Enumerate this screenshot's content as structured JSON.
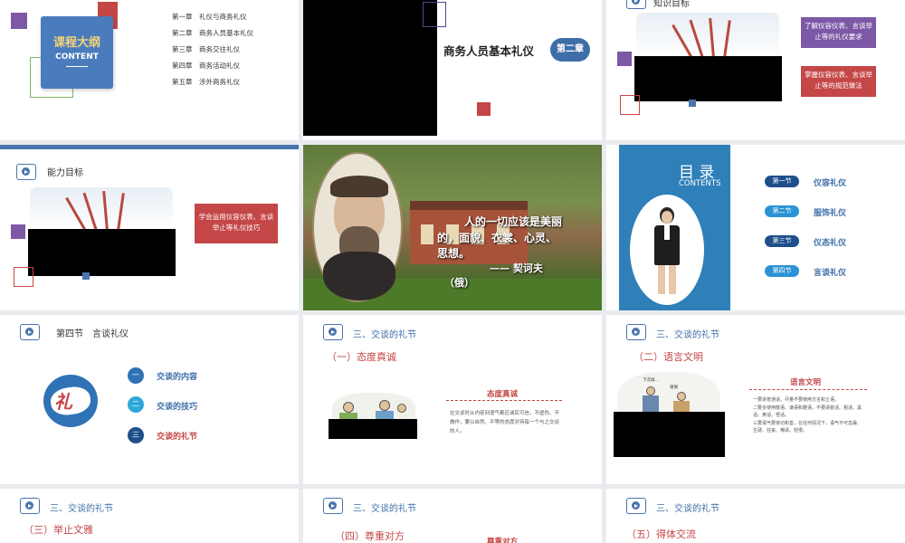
{
  "colors": {
    "accent_blue": "#4a74ab",
    "accent_red": "#c54646",
    "accent_purple": "#7d58a6"
  },
  "slide1": {
    "badge_title": "课程大纲",
    "badge_sub": "CONTENT",
    "chapters": [
      "第一章　礼仪与商务礼仪",
      "第二章　商务人员基本礼仪",
      "第三章　商务交往礼仪",
      "第四章　商务活动礼仪",
      "第五章　涉外商务礼仪"
    ]
  },
  "slide2": {
    "title": "商务人员基本礼仪",
    "badge": "第二章"
  },
  "slide3": {
    "header": "知识目标",
    "goal1": "了解仪容仪表、言谈举止等的礼仪要求",
    "goal2": "掌握仪容仪表、言谈举止等的规范做法"
  },
  "slide4": {
    "header": "能力目标",
    "goal": "学会运用仪容仪表、言谈举止等礼仪技巧"
  },
  "slide5": {
    "quote_line1": "人的一切应该是美丽",
    "quote_line2": "的，面貌、衣裳、心灵、",
    "quote_line3": "思想。",
    "author": "——  契诃夫",
    "country": "（俄）"
  },
  "slide6": {
    "title": "目 录",
    "subtitle": "CONTENTS",
    "items": [
      {
        "num": "第一节",
        "label": "仪容礼仪"
      },
      {
        "num": "第二节",
        "label": "服饰礼仪"
      },
      {
        "num": "第三节",
        "label": "仪态礼仪"
      },
      {
        "num": "第四节",
        "label": "言谈礼仪"
      }
    ]
  },
  "slide7": {
    "header": "第四节　言谈礼仪",
    "logo_text": "礼",
    "items": [
      {
        "num": "一",
        "label": "交谈的内容"
      },
      {
        "num": "二",
        "label": "交谈的技巧"
      },
      {
        "num": "三",
        "label": "交谈的礼节"
      }
    ]
  },
  "slide8": {
    "header": "三、交谈的礼节",
    "subheader": "（一）态度真诚",
    "box_title": "态度真诚",
    "body": "在交谈时从内容到语气都应诚实可信，不虚伪、不做作，要以自然、平等的态度对待每一个与之交谈的人。"
  },
  "slide9": {
    "header": "三、交谈的礼节",
    "subheader": "（二）语言文明",
    "box_title": "语言文明",
    "body": [
      "一要讲普通话，尽量不要使用方言和土语。",
      "二要多使用敬语、谦语和雅语，不要讲脏话、粗话、黑话、黄话、怪话。",
      "三要语气要亲切和善，在任何情况下，语气不可急躁、生硬、狂妄、嘲讽、轻慢。"
    ],
    "bubble1": "下次再…",
    "bubble2": "谢谢"
  },
  "slide10": {
    "header": "三、交谈的礼节",
    "subheader": "（三）举止文雅"
  },
  "slide11": {
    "header": "三、交谈的礼节",
    "subheader": "（四）尊重对方",
    "box_title": "尊重对方"
  },
  "slide12": {
    "header": "三、交谈的礼节",
    "subheader": "（五）得体交流"
  }
}
